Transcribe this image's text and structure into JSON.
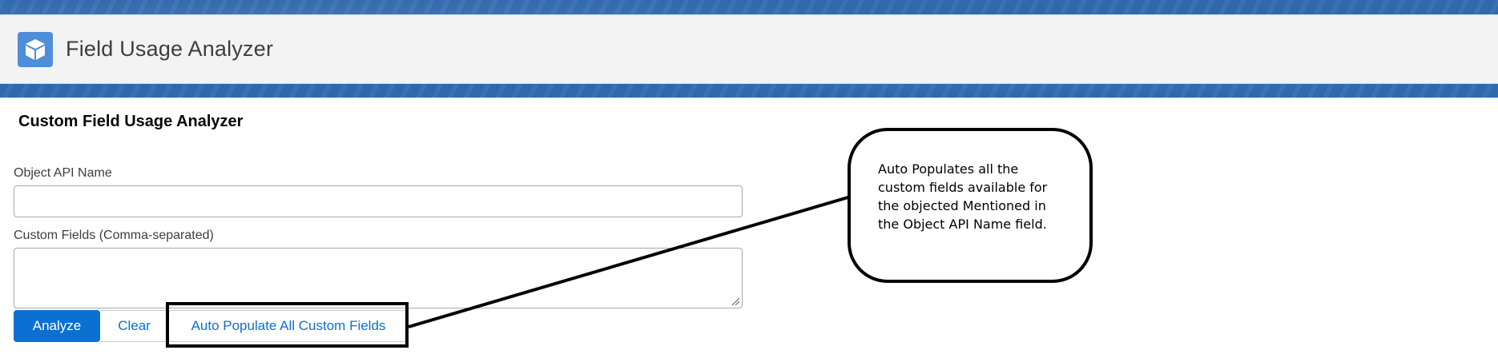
{
  "app": {
    "title": "Field Usage Analyzer",
    "icon": "cube-icon"
  },
  "card": {
    "title": "Custom Field Usage Analyzer"
  },
  "form": {
    "object_label": "Object API Name",
    "object_value": "",
    "fields_label": "Custom Fields (Comma-separated)",
    "fields_value": ""
  },
  "buttons": {
    "analyze": "Analyze",
    "clear": "Clear",
    "auto_populate": "Auto Populate All Custom Fields"
  },
  "callout": {
    "lines": [
      "Auto Populates all the",
      "custom fields available for",
      "the objected Mentioned in",
      "the Object API Name field."
    ]
  },
  "colors": {
    "brand_blue": "#0b70d2",
    "banner_blue": "#2f68ad",
    "icon_blue": "#4f8ed8"
  }
}
